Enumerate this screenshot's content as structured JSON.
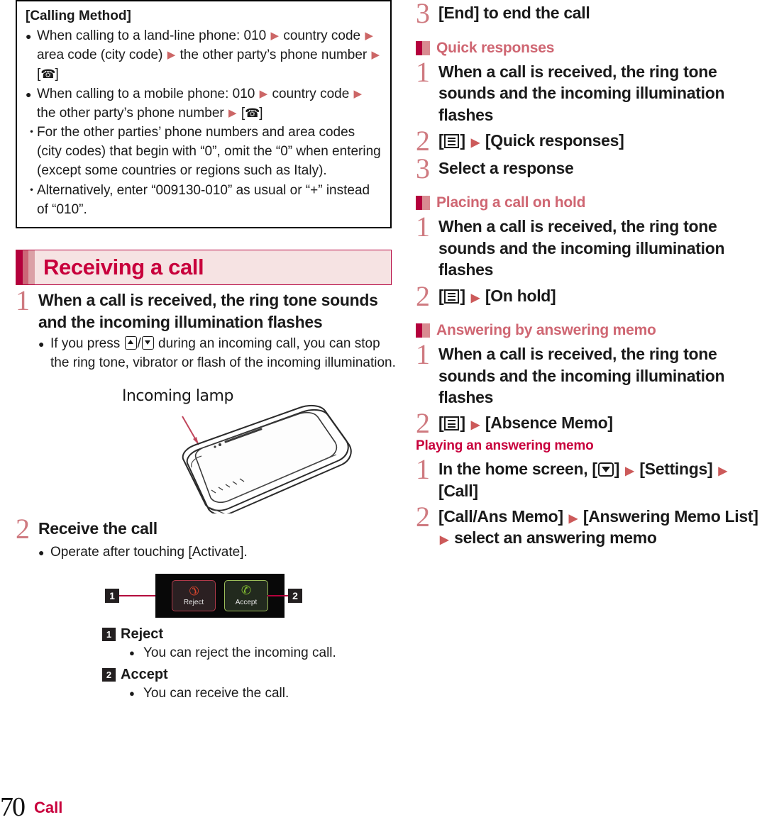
{
  "note_box": {
    "title": "[Calling Method]",
    "bullets": [
      {
        "marker": "●",
        "segments": [
          {
            "t": "text",
            "v": "When calling to a land-line phone: 010 "
          },
          {
            "t": "arrow"
          },
          {
            "t": "text",
            "v": " country code "
          },
          {
            "t": "arrow"
          },
          {
            "t": "text",
            "v": " area code (city code) "
          },
          {
            "t": "arrow"
          },
          {
            "t": "text",
            "v": " the other party’s phone number "
          },
          {
            "t": "arrow"
          },
          {
            "t": "text",
            "v": " ["
          },
          {
            "t": "phone-icon"
          },
          {
            "t": "text",
            "v": "]"
          }
        ]
      },
      {
        "marker": "●",
        "segments": [
          {
            "t": "text",
            "v": "When calling to a mobile phone: 010 "
          },
          {
            "t": "arrow"
          },
          {
            "t": "text",
            "v": " country code "
          },
          {
            "t": "arrow"
          },
          {
            "t": "text",
            "v": " the other party’s phone number "
          },
          {
            "t": "arrow"
          },
          {
            "t": "text",
            "v": " ["
          },
          {
            "t": "phone-icon"
          },
          {
            "t": "text",
            "v": "]"
          }
        ]
      }
    ],
    "dashes": [
      "For the other parties’ phone numbers and area codes (city codes) that begin with “0”, omit the “0” when entering (except some countries or regions such as Italy).",
      "Alternatively, enter “009130-010” as usual or “+” instead of “010”."
    ],
    "dash_marker": "・"
  },
  "section": {
    "title": "Receiving a call"
  },
  "left_steps": {
    "step1_num": "1",
    "step1_text": "When a call is received, the ring tone sounds and the incoming illumination flashes",
    "step1_note_bullet": "●",
    "step1_note_a": "If you press ",
    "step1_note_b": "/",
    "step1_note_c": " during an incoming call, you can stop the ring tone, vibrator or flash of the incoming illumination.",
    "step2_num": "2",
    "step2_text": "Receive the call",
    "step2_note_bullet": "●",
    "step2_note": "Operate after touching [Activate]."
  },
  "illustration": {
    "label": "Incoming lamp"
  },
  "reject_accept": {
    "callout_1": "1",
    "callout_2": "2",
    "reject_label": "Reject",
    "accept_label": "Accept",
    "reject_glyph": "✆",
    "accept_glyph": "✆"
  },
  "legend": [
    {
      "num": "1",
      "title": "Reject",
      "bullet": "●",
      "note": "You can reject the incoming call."
    },
    {
      "num": "2",
      "title": "Accept",
      "bullet": "●",
      "note": "You can receive the call."
    }
  ],
  "footer": {
    "page_number": "70",
    "label": "Call"
  },
  "right": {
    "step3_num": "3",
    "step3_text": "[End] to end the call",
    "quick_responses": {
      "heading": "Quick responses",
      "s1_num": "1",
      "s1_text": "When a call is received, the ring tone sounds and the incoming illumination flashes",
      "s2_num": "2",
      "s2_pre": "[",
      "s2_mid": "] ",
      "s2_post": " [Quick responses]",
      "s3_num": "3",
      "s3_text": "Select a response"
    },
    "placing_on_hold": {
      "heading": "Placing a call on hold",
      "s1_num": "1",
      "s1_text": "When a call is received, the ring tone sounds and the incoming illumination flashes",
      "s2_num": "2",
      "s2_pre": "[",
      "s2_mid": "] ",
      "s2_post": " [On hold]"
    },
    "answering_memo": {
      "heading": "Answering by answering memo",
      "s1_num": "1",
      "s1_text": "When a call is received, the ring tone sounds and the incoming illumination flashes",
      "s2_num": "2",
      "s2_pre": "[",
      "s2_post": " [Absence Memo]",
      "sub_heading": "Playing an answering memo",
      "p1_num": "1",
      "p1_a": "In the home screen, [",
      "p1_b": "] ",
      "p1_c": " [Settings] ",
      "p1_d": " [Call]",
      "p2_num": "2",
      "p2_a": "[Call/Ans Memo] ",
      "p2_b": " [Answering Memo List] ",
      "p2_c": " select an answering memo"
    }
  }
}
